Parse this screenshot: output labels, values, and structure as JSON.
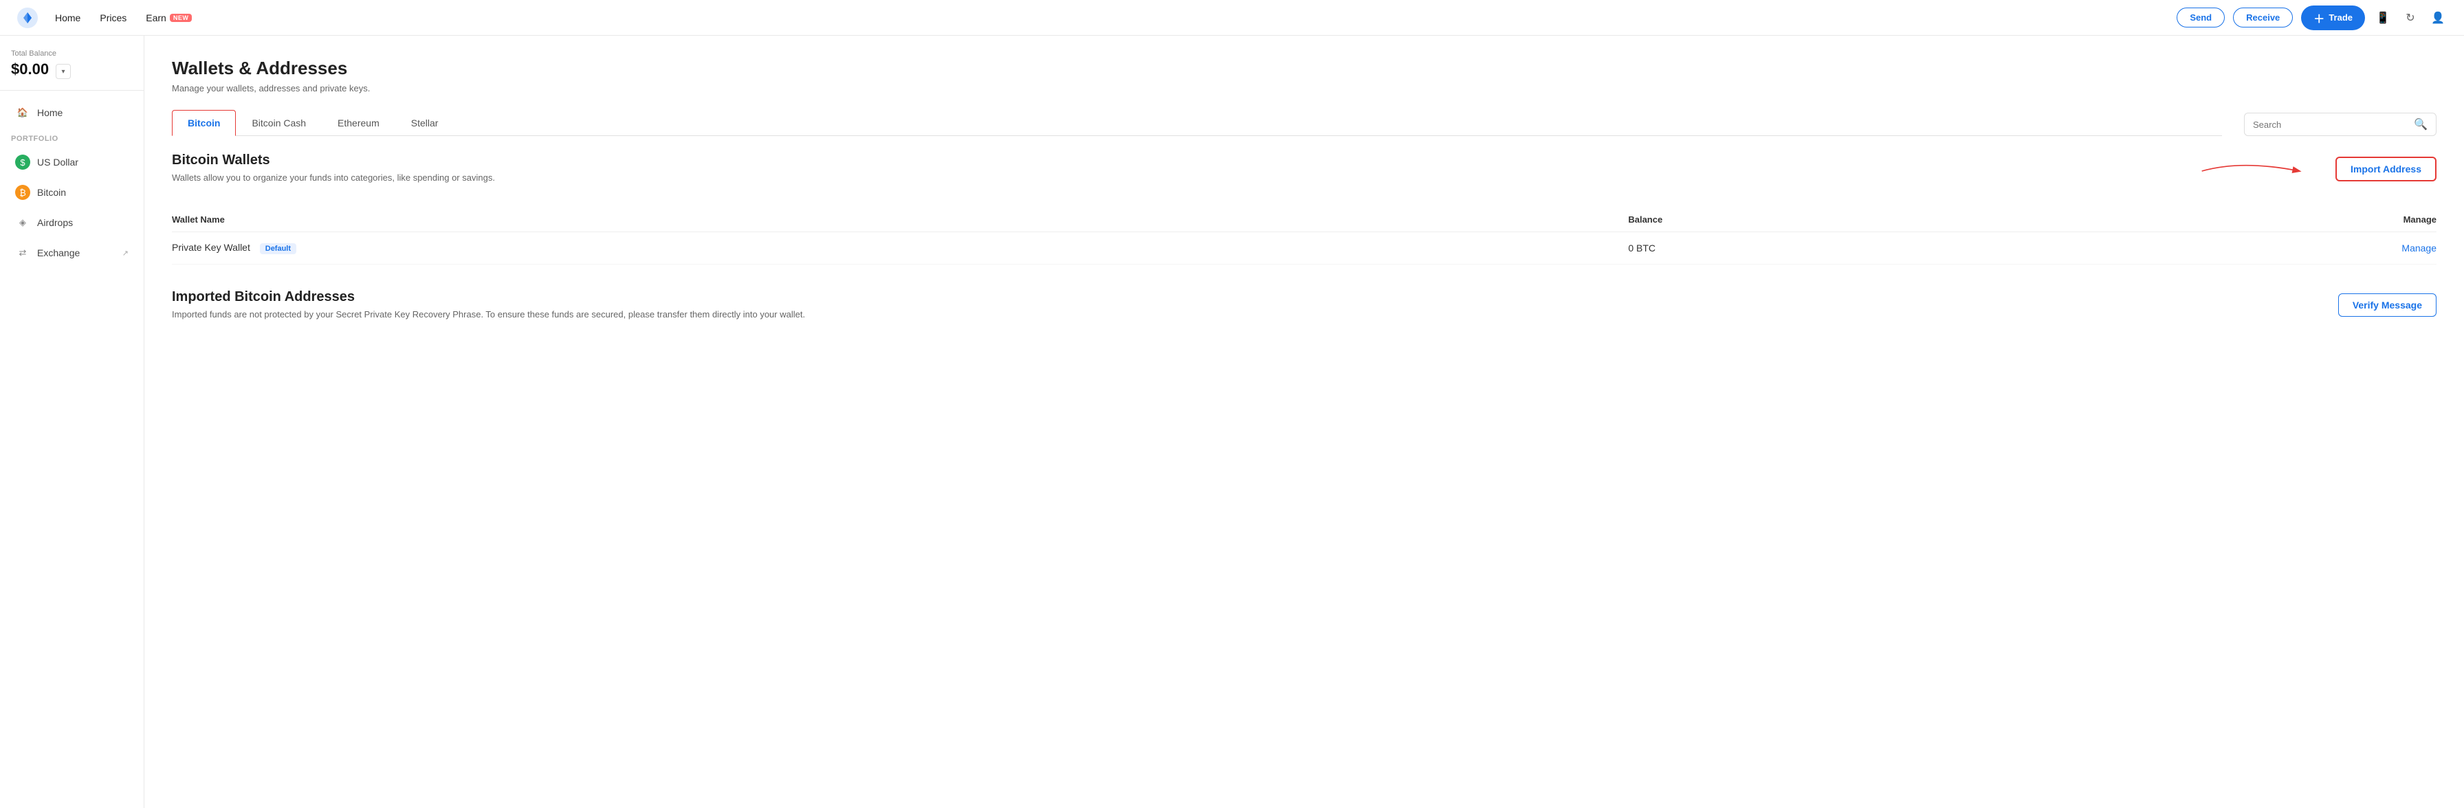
{
  "topnav": {
    "logo_alt": "Blockchain Logo",
    "links": [
      {
        "id": "home",
        "label": "Home"
      },
      {
        "id": "prices",
        "label": "Prices"
      },
      {
        "id": "earn",
        "label": "Earn",
        "badge": "NEW"
      }
    ],
    "send_label": "Send",
    "receive_label": "Receive",
    "trade_label": "Trade"
  },
  "sidebar": {
    "balance_label": "Total Balance",
    "balance_value": "$0.00",
    "portfolio_label": "Portfolio",
    "items": [
      {
        "id": "home",
        "label": "Home",
        "icon": "🏠",
        "type": "home"
      },
      {
        "id": "us-dollar",
        "label": "US Dollar",
        "icon": "$",
        "type": "usd"
      },
      {
        "id": "bitcoin",
        "label": "Bitcoin",
        "icon": "₿",
        "type": "btc"
      },
      {
        "id": "airdrops",
        "label": "Airdrops",
        "icon": "◈",
        "type": "air"
      },
      {
        "id": "exchange",
        "label": "Exchange",
        "icon": "⇄",
        "type": "exc",
        "ext": true
      }
    ]
  },
  "page": {
    "title": "Wallets & Addresses",
    "subtitle": "Manage your wallets, addresses and private keys."
  },
  "tabs": [
    {
      "id": "bitcoin",
      "label": "Bitcoin",
      "active": true
    },
    {
      "id": "bitcoin-cash",
      "label": "Bitcoin Cash",
      "active": false
    },
    {
      "id": "ethereum",
      "label": "Ethereum",
      "active": false
    },
    {
      "id": "stellar",
      "label": "Stellar",
      "active": false
    }
  ],
  "search": {
    "placeholder": "Search"
  },
  "wallet_section": {
    "title": "Bitcoin Wallets",
    "subtitle": "Wallets allow you to organize your funds into categories, like spending or savings.",
    "import_button_label": "Import Address",
    "table": {
      "col_name": "Wallet Name",
      "col_balance": "Balance",
      "col_manage": "Manage",
      "rows": [
        {
          "name": "Private Key Wallet",
          "badge": "Default",
          "balance": "0 BTC",
          "manage_label": "Manage"
        }
      ]
    }
  },
  "imported_section": {
    "title": "Imported Bitcoin Addresses",
    "desc": "Imported funds are not protected by your Secret Private Key Recovery Phrase. To ensure these funds are secured, please transfer them directly into your wallet.",
    "verify_button_label": "Verify Message"
  }
}
